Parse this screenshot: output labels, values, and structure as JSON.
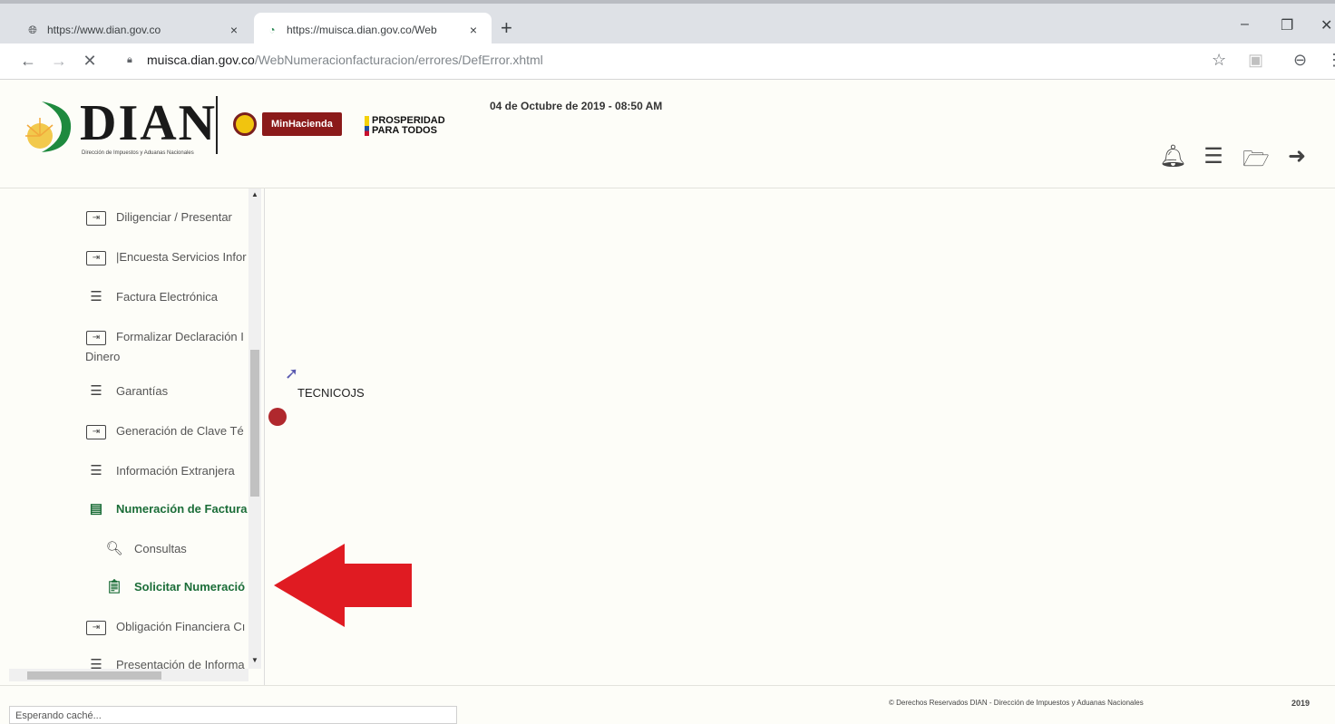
{
  "browser": {
    "tabs": [
      {
        "title": "https://www.dian.gov.co",
        "close": "×",
        "favicon": "globe-icon"
      },
      {
        "title": "https://muisca.dian.gov.co/Web",
        "close": "×",
        "favicon": "dian-favicon"
      }
    ],
    "new_tab": "+",
    "window_controls": {
      "minimize": "–",
      "maximize": "❐",
      "close": "✕"
    },
    "nav": {
      "back": "←",
      "forward": "→",
      "stop": "✕"
    },
    "url_host": "muisca.dian.gov.co",
    "url_path": "/WebNumeracionfacturacion/errores/DefError.xhtml",
    "toolbar_icons": {
      "star": "☆",
      "ext": "▣",
      "profile": "⊖",
      "menu": "⋮"
    }
  },
  "header": {
    "logo_text": "DIAN",
    "logo_sub": "Dirección de Impuestos y Aduanas Nacionales",
    "minhacienda": "MinHacienda",
    "prosperidad_line1": "PROSPERIDAD",
    "prosperidad_line2": "PARA TODOS",
    "date": "04 de Octubre de 2019 - 08:50 AM",
    "icons": [
      "bell-icon",
      "checklist-icon",
      "folder-open-icon",
      "logout-icon"
    ]
  },
  "sidebar": {
    "items": [
      {
        "label": "Diligenciar / Presentar",
        "icon": "enter-box-icon"
      },
      {
        "label": "|Encuesta Servicios Infor",
        "icon": "enter-box-icon"
      },
      {
        "label": "Factura Electrónica",
        "icon": "menu-lines-icon"
      },
      {
        "label": "Formalizar Declaración I",
        "continuation": "Dinero",
        "icon": "enter-box-icon"
      },
      {
        "label": "Garantías",
        "icon": "menu-lines-icon"
      },
      {
        "label": "Generación de Clave Té",
        "icon": "enter-box-icon"
      },
      {
        "label": "Información Extranjera",
        "icon": "menu-lines-icon"
      },
      {
        "label": "Numeración de Factura",
        "icon": "document-list-icon",
        "active": true
      },
      {
        "label": "Consultas",
        "icon": "search-icon",
        "sub": true
      },
      {
        "label": "Solicitar Numeració",
        "icon": "clipboard-icon",
        "sub": true,
        "active": true
      },
      {
        "label": "Obligación Financiera Cı",
        "icon": "enter-box-icon"
      },
      {
        "label": "Presentación de Informa",
        "icon": "menu-lines-icon"
      }
    ]
  },
  "content": {
    "user_label": "TECNICOJS"
  },
  "footer": {
    "copyright": "© Derechos Reservados DIAN - Dirección de Impuestos y Aduanas Nacionales",
    "year": "2019",
    "status": "Esperando caché..."
  },
  "colors": {
    "active_green": "#1b6d38",
    "arrow_red": "#e01b22",
    "minhacienda_red": "#8b1a1a"
  }
}
